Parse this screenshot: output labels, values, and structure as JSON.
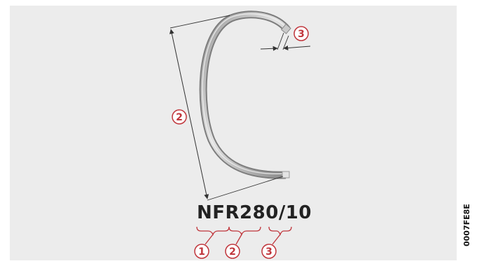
{
  "designation": {
    "text": "NFR280/10",
    "parts": [
      {
        "marker": "1",
        "segment": "NFR"
      },
      {
        "marker": "2",
        "segment": "280"
      },
      {
        "marker": "3",
        "segment": "10"
      }
    ]
  },
  "callouts": {
    "diameter_marker": "2",
    "thickness_marker": "3"
  },
  "image_code": "0007FE8E",
  "colors": {
    "panel_bg": "#ececec",
    "callout_red": "#c0353b",
    "ring_dark": "#7d7d7d",
    "ring_light": "#d8d8d8",
    "dim_line": "#333333"
  }
}
